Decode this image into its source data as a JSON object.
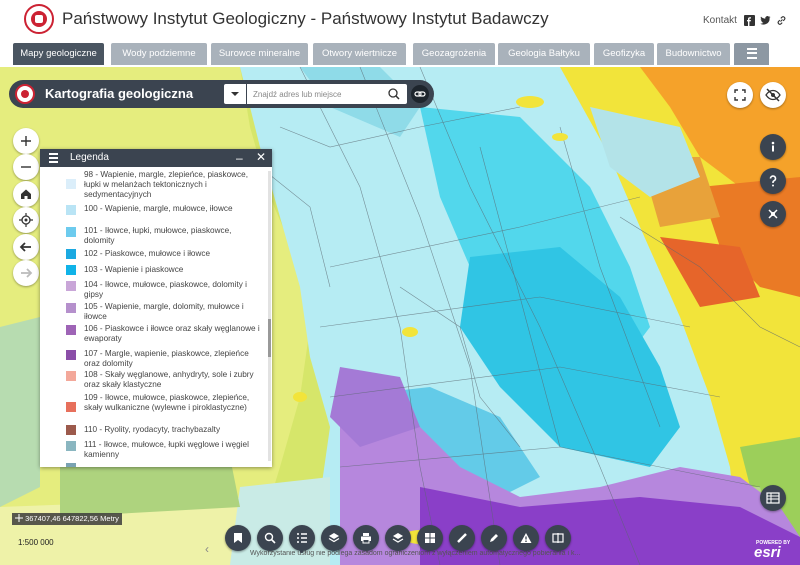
{
  "header": {
    "title": "Państwowy Instytut Geologiczny - Państwowy Instytut Badawczy",
    "kontakt": "Kontakt",
    "social": [
      "f",
      "t",
      "link"
    ]
  },
  "tabs": [
    {
      "label": "Mapy geologiczne",
      "active": true
    },
    {
      "label": "Wody podziemne"
    },
    {
      "label": "Surowce mineralne"
    },
    {
      "label": "Otwory wiertnicze"
    },
    {
      "label": "Geozagrożenia"
    },
    {
      "label": "Geologia Bałtyku"
    },
    {
      "label": "Geofizyka"
    },
    {
      "label": "Budownictwo"
    }
  ],
  "searchbar": {
    "title": "Kartografia geologiczna",
    "placeholder": "Znajdź adres lub miejsce"
  },
  "legend": {
    "title": "Legenda",
    "items": [
      {
        "text": "98 - Wapienie, margle, zlepieńce, piaskowce, łupki w melanżach tektonicznych i sedymentacyjnych",
        "color": "#dbeefa"
      },
      {
        "text": "100 - Wapienie, margle, mułowce, iłowce",
        "color": "#b9e4f5"
      },
      {
        "text": "101 - Iłowce, łupki, mułowce, piaskowce, dolomity",
        "color": "#6dcbee"
      },
      {
        "text": "102 - Piaskowce, mułowce i iłowce",
        "color": "#1ba9e1"
      },
      {
        "text": "103 - Wapienie i piaskowce",
        "color": "#10b3e8"
      },
      {
        "text": "104 - Iłowce, mułowce, piaskowce, dolomity i gipsy",
        "color": "#c9a6d8"
      },
      {
        "text": "105 - Wapienie, margle, dolomity, mułowce i iłowce",
        "color": "#b590cc"
      },
      {
        "text": "106 - Piaskowce i iłowce oraz skały węglanowe i ewaporaty",
        "color": "#9e64b6"
      },
      {
        "text": "107 - Margle, wapienie, piaskowce, zlepieńce oraz dolomity",
        "color": "#8b4ea8"
      },
      {
        "text": "108 - Skały węglanowe, anhydryty, sole i zubry oraz skały klastyczne",
        "color": "#f3a89a"
      },
      {
        "text": "109 - Iłowce, mułowce, piaskowce, zlepieńce, skały wulkaniczne (wylewne i piroklastyczne)",
        "color": "#e7705c"
      },
      {
        "text": "110 - Ryolity, ryodacyty, trachybazalty",
        "color": "#9c5a4c"
      },
      {
        "text": "111 - Iłowce, mułowce, łupki węglowe i węgiel kamienny",
        "color": "#8ab6c0"
      },
      {
        "text": "",
        "color": "#7aa3b3"
      }
    ]
  },
  "map": {
    "coords": "367407,46 647822,56 Metry",
    "scale": "1:500 000",
    "attribution": "Wykorzystanie usług nie podlega zasadom ograniczeniom z wyłączeniem automatycznego pobierania i k...",
    "esri_powered": "POWERED BY",
    "esri_word": "esri"
  },
  "toolbar": [
    "attach",
    "identify",
    "legend",
    "layers",
    "print",
    "basemap",
    "grid",
    "measure",
    "draw",
    "alert",
    "compare"
  ]
}
